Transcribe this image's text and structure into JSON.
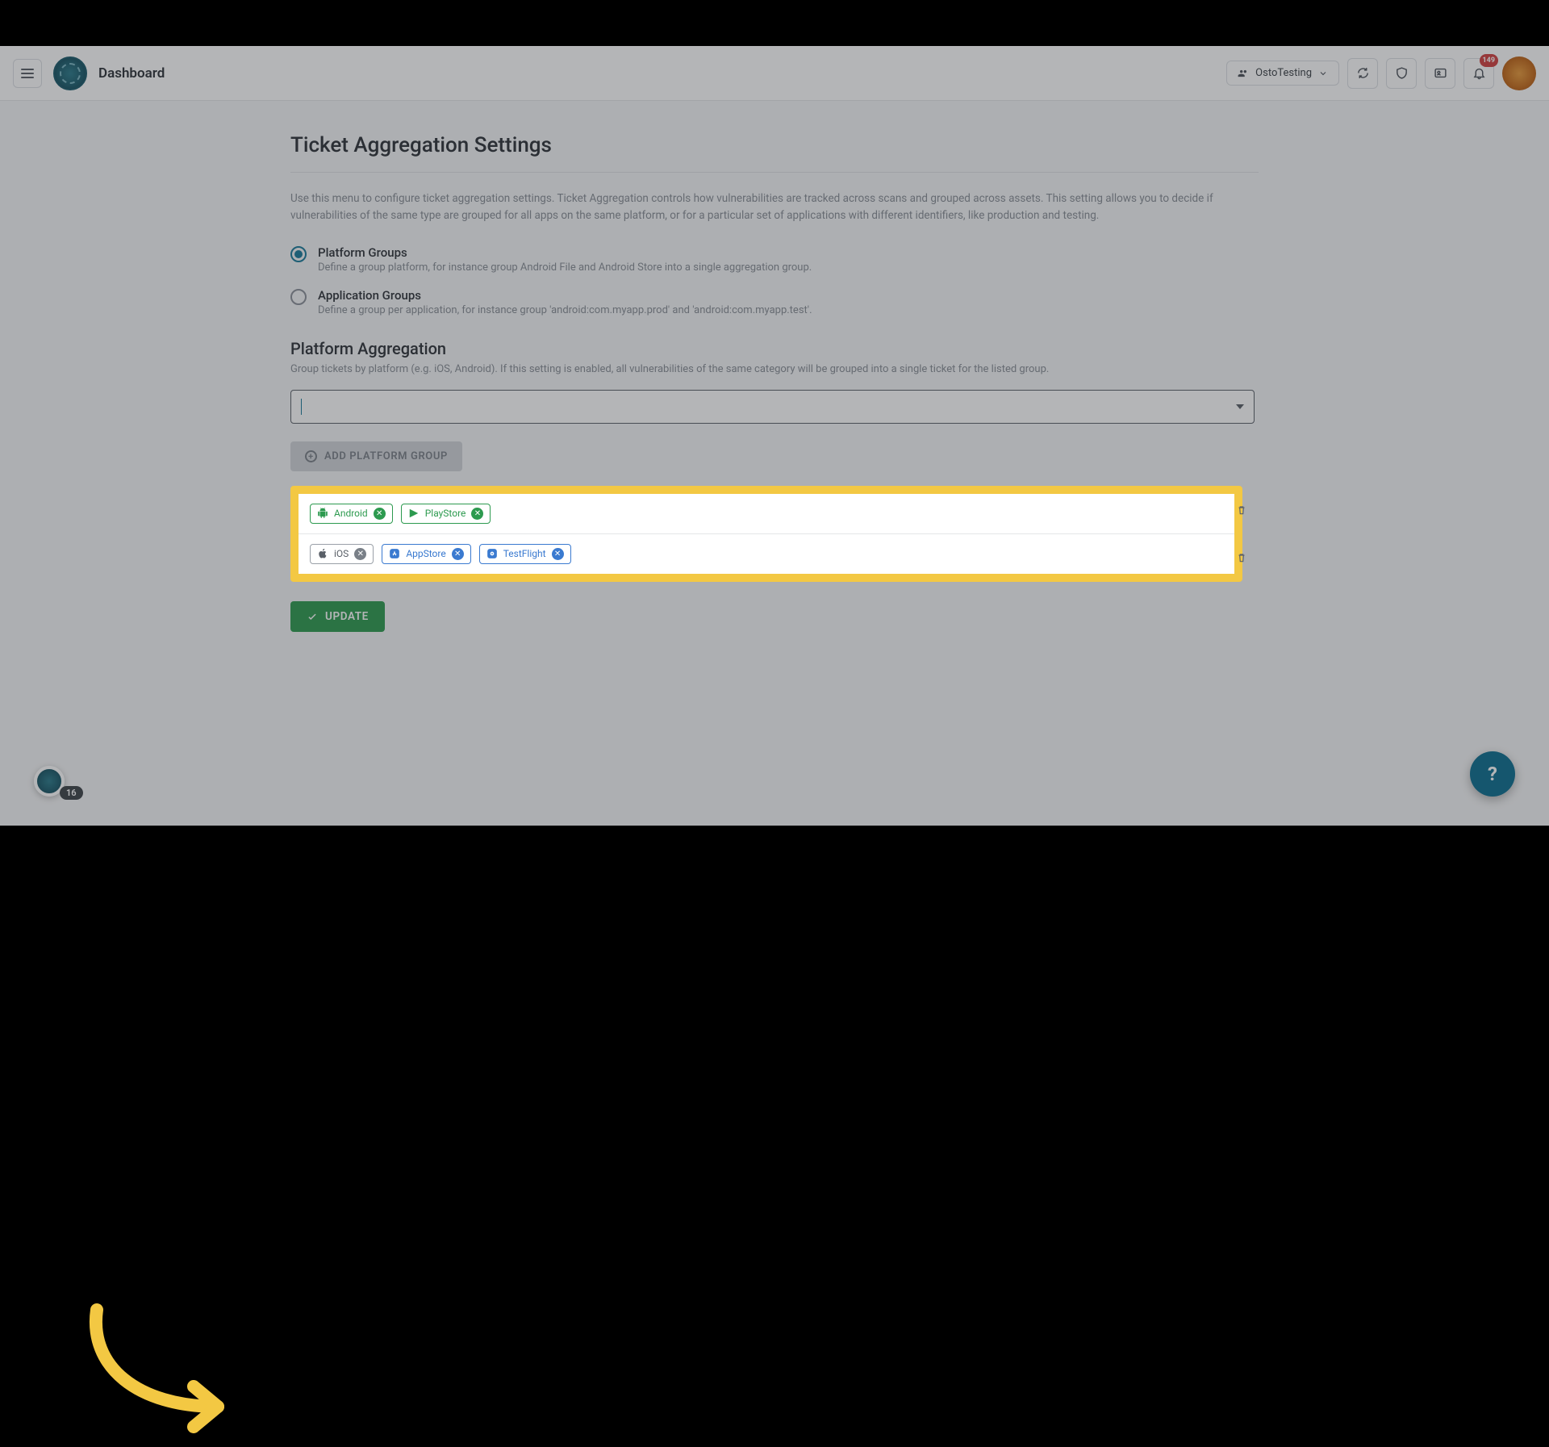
{
  "header": {
    "title": "Dashboard",
    "workspace_label": "OstoTesting",
    "notification_count": "149",
    "floating_count": "16"
  },
  "page": {
    "title": "Ticket Aggregation Settings",
    "description": "Use this menu to configure ticket aggregation settings. Ticket Aggregation controls how vulnerabilities are tracked across scans and grouped across assets. This setting allows you to decide if vulnerabilities of the same type are grouped for all apps on the same platform, or for a particular set of applications with different identifiers, like production and testing."
  },
  "radios": {
    "platform": {
      "title": "Platform Groups",
      "sub": "Define a group platform, for instance group Android File and Android Store into a single aggregation group."
    },
    "application": {
      "title": "Application Groups",
      "sub": "Define a group per application, for instance group 'android:com.myapp.prod' and 'android:com.myapp.test'."
    }
  },
  "section": {
    "title": "Platform Aggregation",
    "sub": "Group tickets by platform (e.g. iOS, Android). If this setting is enabled, all vulnerabilities of the same category will be grouped into a single ticket for the listed group."
  },
  "buttons": {
    "add_group": "ADD PLATFORM GROUP",
    "update": "UPDATE",
    "help": "?"
  },
  "groups": [
    {
      "chips": [
        {
          "label": "Android",
          "style": "green",
          "icon": "android"
        },
        {
          "label": "PlayStore",
          "style": "green",
          "icon": "play"
        }
      ]
    },
    {
      "chips": [
        {
          "label": "iOS",
          "style": "gray",
          "icon": "apple"
        },
        {
          "label": "AppStore",
          "style": "blue",
          "icon": "appstore"
        },
        {
          "label": "TestFlight",
          "style": "blue",
          "icon": "testflight"
        }
      ]
    }
  ]
}
